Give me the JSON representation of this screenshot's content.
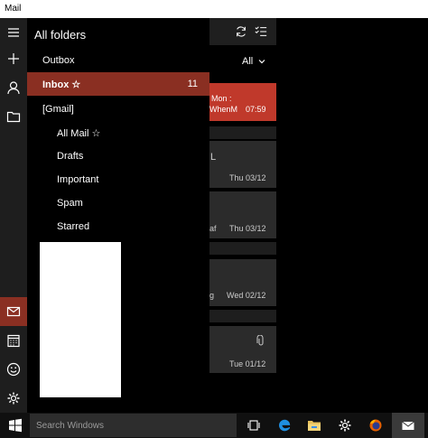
{
  "window": {
    "title": "Mail"
  },
  "rail": {
    "items": [
      {
        "name": "hamburger-icon"
      },
      {
        "name": "new-mail-icon"
      },
      {
        "name": "accounts-icon"
      },
      {
        "name": "folder-icon"
      },
      {
        "name": "mail-icon",
        "active": true
      },
      {
        "name": "calendar-icon"
      },
      {
        "name": "feedback-icon"
      },
      {
        "name": "settings-icon"
      }
    ],
    "accent": "#8a2f22"
  },
  "folders": {
    "title": "All folders",
    "items": [
      {
        "label": "Outbox",
        "count": "",
        "indent": 1,
        "selected": false
      },
      {
        "label": "Inbox ☆",
        "count": "11",
        "indent": 1,
        "selected": true
      },
      {
        "label": "[Gmail]",
        "count": "",
        "indent": 1,
        "selected": false
      },
      {
        "label": "All Mail ☆",
        "count": "",
        "indent": 2,
        "selected": false
      },
      {
        "label": "Drafts",
        "count": "",
        "indent": 2,
        "selected": false
      },
      {
        "label": "Important",
        "count": "",
        "indent": 2,
        "selected": false
      },
      {
        "label": "Spam",
        "count": "",
        "indent": 2,
        "selected": false
      },
      {
        "label": "Starred",
        "count": "",
        "indent": 2,
        "selected": false
      }
    ]
  },
  "message_list": {
    "filter": "All",
    "messages": [
      {
        "line1": "Mon :",
        "line2": "WhenM",
        "time": "07:59",
        "selected": true
      },
      {
        "line1": "L",
        "line2": "",
        "time": "Thu 03/12",
        "selected": false
      },
      {
        "line1": "",
        "line2": "af",
        "time": "Thu 03/12",
        "selected": false
      },
      {
        "line1": "",
        "line2": "g",
        "time": "Wed 02/12",
        "selected": false
      },
      {
        "line1": "",
        "line2": "",
        "time": "Tue 01/12",
        "selected": false
      }
    ]
  },
  "taskbar": {
    "search_placeholder": "Search Windows",
    "icons": [
      "task-view-icon",
      "edge-icon",
      "file-explorer-icon",
      "settings-icon",
      "firefox-icon",
      "mail-icon"
    ]
  }
}
